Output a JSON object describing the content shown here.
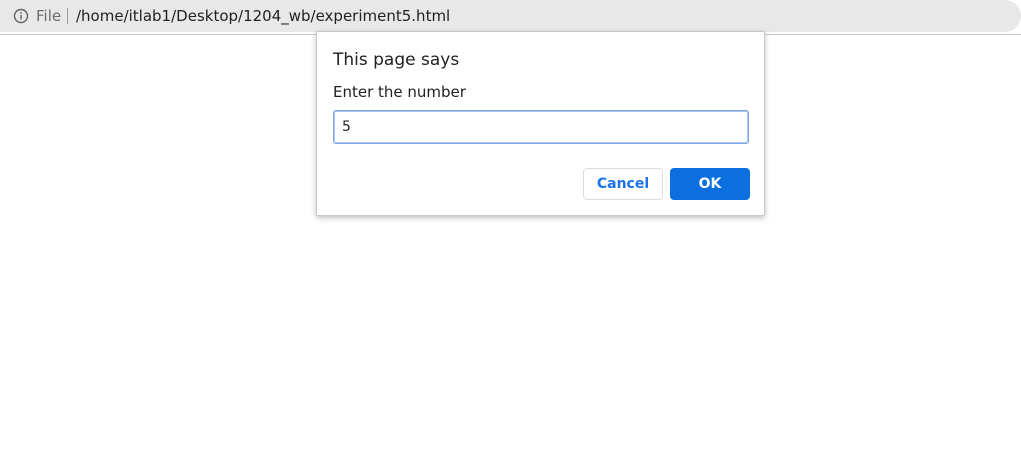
{
  "address_bar": {
    "info_icon": "info-circle-icon",
    "scheme_label": "File",
    "url": "/home/itlab1/Desktop/1204_wb/experiment5.html"
  },
  "dialog": {
    "title": "This page says",
    "message": "Enter the number",
    "input_value": "5",
    "cancel_label": "Cancel",
    "ok_label": "OK"
  },
  "colors": {
    "accent": "#0b6fe0",
    "link_blue": "#1a73e8",
    "toolbar_bg": "#e8e8e8"
  }
}
